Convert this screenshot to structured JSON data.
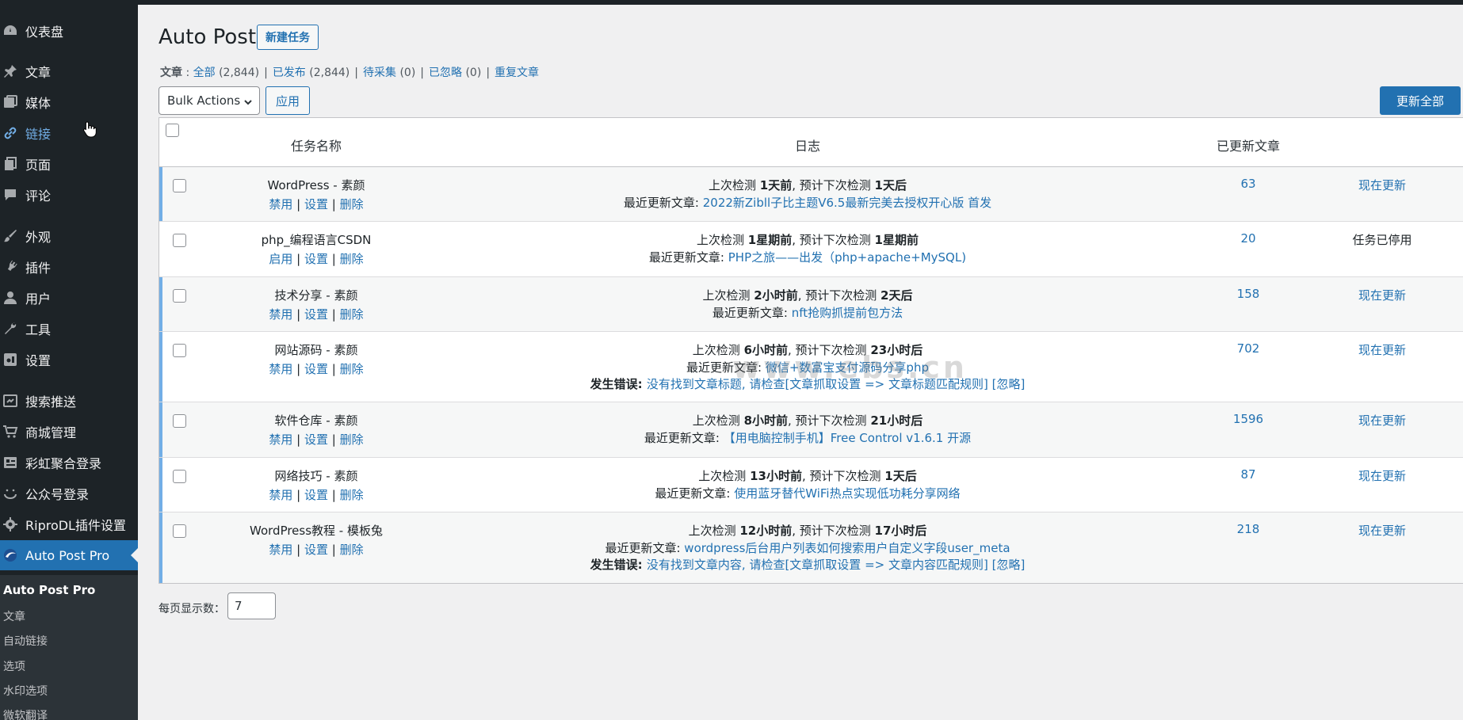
{
  "sidebar": {
    "items": [
      {
        "label": "仪表盘",
        "icon": "dashboard-icon"
      },
      {
        "label": "文章",
        "icon": "pin-icon"
      },
      {
        "label": "媒体",
        "icon": "media-icon"
      },
      {
        "label": "链接",
        "icon": "link-icon"
      },
      {
        "label": "页面",
        "icon": "page-icon"
      },
      {
        "label": "评论",
        "icon": "comment-icon"
      },
      {
        "label": "外观",
        "icon": "brush-icon"
      },
      {
        "label": "插件",
        "icon": "plugin-icon"
      },
      {
        "label": "用户",
        "icon": "user-icon"
      },
      {
        "label": "工具",
        "icon": "wrench-icon"
      },
      {
        "label": "设置",
        "icon": "settings-icon"
      },
      {
        "label": "搜索推送",
        "icon": "push-icon"
      },
      {
        "label": "商城管理",
        "icon": "cart-icon"
      },
      {
        "label": "彩虹聚合登录",
        "icon": "login-icon"
      },
      {
        "label": "公众号登录",
        "icon": "wechat-icon"
      },
      {
        "label": "RiproDL插件设置",
        "icon": "gear-icon"
      },
      {
        "label": "Auto Post Pro",
        "icon": "autopost-icon"
      }
    ],
    "submenu": [
      "Auto Post Pro",
      "文章",
      "自动链接",
      "选项",
      "水印选项",
      "微软翻译"
    ]
  },
  "page": {
    "title": "Auto Post",
    "new_task_button": "新建任务",
    "filters": {
      "label": "文章",
      "items": [
        {
          "label": "全部",
          "count": "(2,844)"
        },
        {
          "label": "已发布",
          "count": "(2,844)"
        },
        {
          "label": "待采集",
          "count": "(0)"
        },
        {
          "label": "已忽略",
          "count": "(0)"
        },
        {
          "label": "重复文章",
          "count": ""
        }
      ]
    },
    "bulk_actions": "Bulk Actions",
    "apply_button": "应用",
    "update_all_button": "更新全部",
    "watermark": "www.ebs.cn"
  },
  "table": {
    "headers": {
      "name": "任务名称",
      "log": "日志",
      "updated": "已更新文章"
    },
    "rows": [
      {
        "name": "WordPress - 素颜",
        "actions": [
          "禁用",
          "设置",
          "删除"
        ],
        "check_pre": "上次检测 ",
        "check_last": "1天前",
        "check_mid": ", 预计下次检测 ",
        "check_next": "1天后",
        "latest_label": "最近更新文章: ",
        "latest": "2022新Zibll子比主题V6.5最新完美去授权开心版 首发",
        "error_label": "",
        "error": "",
        "error_ignore": "",
        "count": "63",
        "action": "现在更新"
      },
      {
        "name": "php_编程语言CSDN",
        "actions": [
          "启用",
          "设置",
          "删除"
        ],
        "check_pre": "上次检测 ",
        "check_last": "1星期前",
        "check_mid": ", 预计下次检测 ",
        "check_next": "1星期前",
        "latest_label": "最近更新文章: ",
        "latest": "PHP之旅——出发（php+apache+MySQL)",
        "error_label": "",
        "error": "",
        "error_ignore": "",
        "count": "20",
        "action": "任务已停用"
      },
      {
        "name": "技术分享 - 素颜",
        "actions": [
          "禁用",
          "设置",
          "删除"
        ],
        "check_pre": "上次检测 ",
        "check_last": "2小时前",
        "check_mid": ", 预计下次检测 ",
        "check_next": "2天后",
        "latest_label": "最近更新文章: ",
        "latest": "nft抢购抓提前包方法",
        "error_label": "",
        "error": "",
        "error_ignore": "",
        "count": "158",
        "action": "现在更新"
      },
      {
        "name": "网站源码 - 素颜",
        "actions": [
          "禁用",
          "设置",
          "删除"
        ],
        "check_pre": "上次检测 ",
        "check_last": "6小时前",
        "check_mid": ", 预计下次检测 ",
        "check_next": "23小时后",
        "latest_label": "最近更新文章: ",
        "latest": "微信+数富宝支付源码分享php",
        "error_label": "发生错误: ",
        "error": "没有找到文章标题, 请检查[文章抓取设置 => 文章标题匹配规则]",
        "error_ignore": "[忽略]",
        "count": "702",
        "action": "现在更新"
      },
      {
        "name": "软件仓库 - 素颜",
        "actions": [
          "禁用",
          "设置",
          "删除"
        ],
        "check_pre": "上次检测 ",
        "check_last": "8小时前",
        "check_mid": ", 预计下次检测 ",
        "check_next": "21小时后",
        "latest_label": "最近更新文章: ",
        "latest": "【用电脑控制手机】Free Control v1.6.1 开源",
        "error_label": "",
        "error": "",
        "error_ignore": "",
        "count": "1596",
        "action": "现在更新"
      },
      {
        "name": "网络技巧 - 素颜",
        "actions": [
          "禁用",
          "设置",
          "删除"
        ],
        "check_pre": "上次检测 ",
        "check_last": "13小时前",
        "check_mid": ", 预计下次检测 ",
        "check_next": "1天后",
        "latest_label": "最近更新文章: ",
        "latest": "使用蓝牙替代WiFi热点实现低功耗分享网络",
        "error_label": "",
        "error": "",
        "error_ignore": "",
        "count": "87",
        "action": "现在更新"
      },
      {
        "name": "WordPress教程 - 模板兔",
        "actions": [
          "禁用",
          "设置",
          "删除"
        ],
        "check_pre": "上次检测 ",
        "check_last": "12小时前",
        "check_mid": ", 预计下次检测 ",
        "check_next": "17小时后",
        "latest_label": "最近更新文章: ",
        "latest": "wordpress后台用户列表如何搜索用户自定义字段user_meta",
        "error_label": "发生错误: ",
        "error": "没有找到文章内容, 请检查[文章抓取设置 => 文章内容匹配规则]",
        "error_ignore": "[忽略]",
        "count": "218",
        "action": "现在更新"
      }
    ]
  },
  "pagination": {
    "per_page_label": "每页显示数：",
    "per_page_value": "7"
  }
}
